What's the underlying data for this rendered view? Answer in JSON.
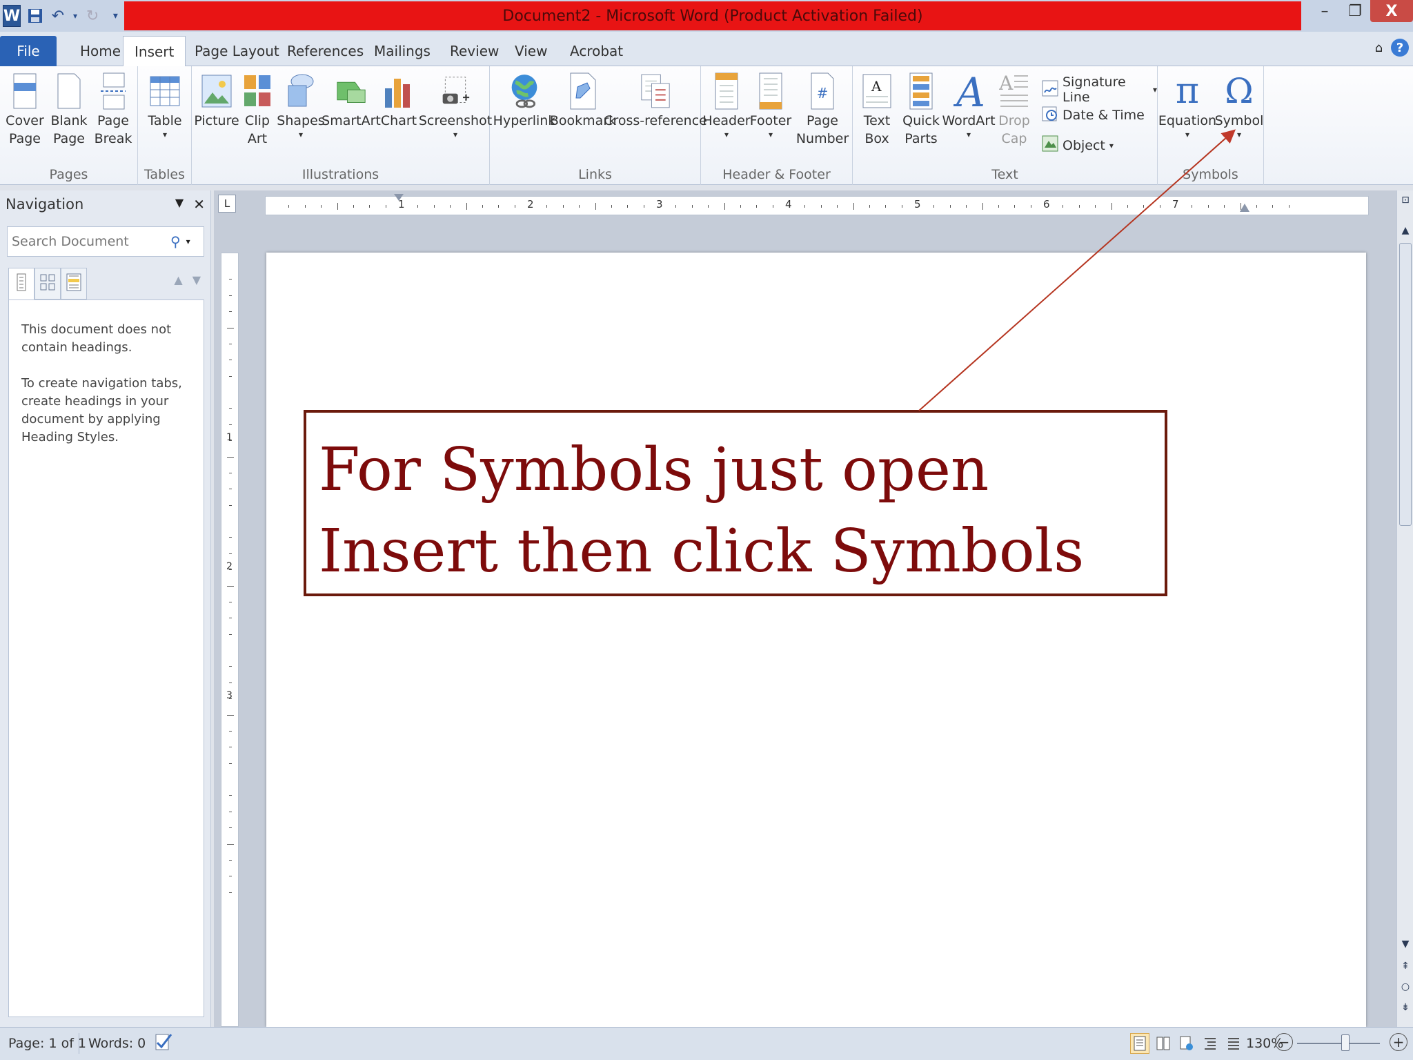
{
  "window": {
    "title": "Document2  -  Microsoft Word (Product Activation Failed)",
    "controls": {
      "minimize": "–",
      "restore": "❐",
      "close": "X"
    }
  },
  "tabs": {
    "file": "File",
    "home": "Home",
    "insert": "Insert",
    "page_layout": "Page Layout",
    "references": "References",
    "mailings": "Mailings",
    "review": "Review",
    "view": "View",
    "acrobat": "Acrobat",
    "help": "?"
  },
  "ribbon": {
    "pages": {
      "label": "Pages",
      "cover": "Cover\nPage",
      "blank": "Blank\nPage",
      "break": "Page\nBreak"
    },
    "tables": {
      "label": "Tables",
      "table": "Table"
    },
    "illustrations": {
      "label": "Illustrations",
      "picture": "Picture",
      "clipart": "Clip\nArt",
      "shapes": "Shapes",
      "smartart": "SmartArt",
      "chart": "Chart",
      "screenshot": "Screenshot"
    },
    "links": {
      "label": "Links",
      "hyperlink": "Hyperlink",
      "bookmark": "Bookmark",
      "crossref": "Cross-reference"
    },
    "header_footer": {
      "label": "Header & Footer",
      "header": "Header",
      "footer": "Footer",
      "page_number": "Page\nNumber"
    },
    "text": {
      "label": "Text",
      "textbox": "Text\nBox",
      "quickparts": "Quick\nParts",
      "wordart": "WordArt",
      "dropcap": "Drop\nCap",
      "signature": "Signature Line",
      "datetime": "Date & Time",
      "object": "Object"
    },
    "symbols": {
      "label": "Symbols",
      "equation": "Equation",
      "symbol": "Symbol",
      "equation_glyph": "π",
      "symbol_glyph": "Ω"
    }
  },
  "navigation": {
    "title": "Navigation",
    "search_placeholder": "Search Document",
    "message1": "This document does not contain headings.",
    "message2": "To create navigation tabs, create headings in your document by applying Heading Styles."
  },
  "ruler": {
    "numbers": [
      "1",
      "2",
      "3",
      "4",
      "5",
      "6",
      "7"
    ],
    "vnumbers": [
      "1",
      "2",
      "3"
    ]
  },
  "document": {
    "callout_line1": "For Symbols just open",
    "callout_line2": "Insert then click Symbols",
    "callout_color": "#7d0b0b"
  },
  "statusbar": {
    "page": "Page: 1 of 1",
    "words": "Words: 0",
    "zoom": "130%"
  },
  "colors": {
    "titlebar_red": "#e81414",
    "file_tab": "#2a62b5"
  }
}
